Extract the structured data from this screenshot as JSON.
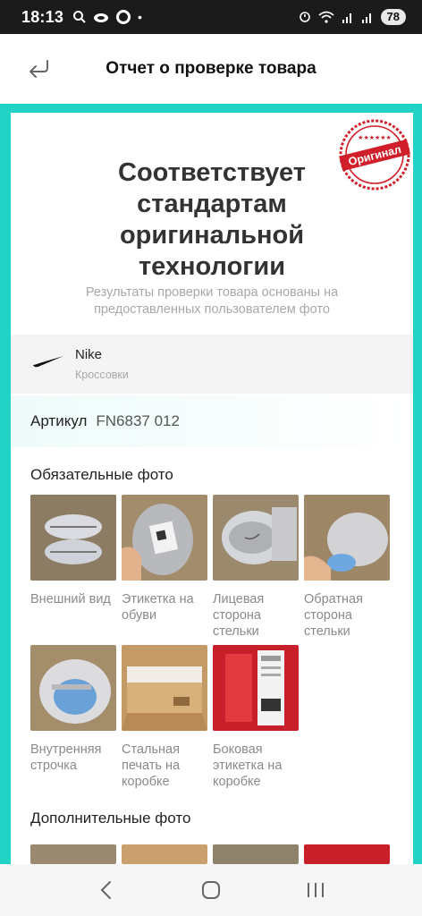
{
  "status_bar": {
    "time": "18:13",
    "battery": "78",
    "icons": [
      "search-icon",
      "cloud-icon",
      "app-icon",
      "dot-icon",
      "alarm-icon",
      "wifi-icon",
      "signal-icon",
      "signal-icon"
    ]
  },
  "header": {
    "title": "Отчет о проверке товара",
    "back_icon": "back-arrow-icon"
  },
  "stamp": {
    "text": "Оригинал",
    "color": "#d01f2a"
  },
  "result": {
    "verdict": "Соответствует стандартам оригинальной технологии",
    "subtitle": "Результаты проверки товара основаны на предоставленных пользователем фото"
  },
  "product": {
    "brand": "Nike",
    "category": "Кроссовки",
    "sku_label": "Артикул",
    "sku_value": "FN6837 012"
  },
  "required_photos": {
    "title": "Обязательные фото",
    "items": [
      {
        "caption": "Внешний вид"
      },
      {
        "caption": "Этикетка на обуви"
      },
      {
        "caption": "Лицевая сторона стельки"
      },
      {
        "caption": "Обратная сторона стельки"
      },
      {
        "caption": "Внутренняя строчка"
      },
      {
        "caption": "Стальная печать на коробке"
      },
      {
        "caption": "Боковая этикетка на коробке"
      }
    ]
  },
  "additional_photos": {
    "title": "Дополнительные фото"
  },
  "colors": {
    "accent": "#22d3c5",
    "stamp_red": "#d01f2a"
  }
}
